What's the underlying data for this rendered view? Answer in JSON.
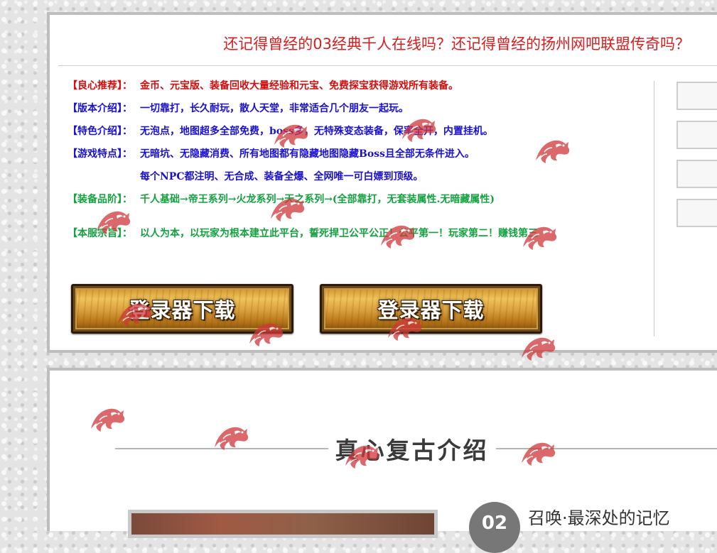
{
  "header": {
    "headline": "还记得曾经的03经典千人在线吗？还记得曾经的扬州网吧联盟传奇吗？"
  },
  "info_rows": [
    {
      "label": "【良心推荐】：",
      "text": "金币、元宝版、装备回收大量经验和元宝、免费探宝获得游戏所有装备。",
      "color": "#d40c0c"
    },
    {
      "label": "【版本介绍】：",
      "text": "一切靠打，长久耐玩，散人天堂，非常适合几个朋友一起玩。",
      "color": "#1a11cf"
    },
    {
      "label": "【特色介绍】：",
      "text": "无泡点，地图超多全部免费，boss多，无特殊变态装备，保率全开，内置挂机。",
      "color": "#1a11cf"
    },
    {
      "label": "【游戏特点】：",
      "text": "无暗坑、无隐藏消费、所有地图都有隐藏地图隐藏Boss且全部无条件进入。",
      "color": "#1a11cf"
    },
    {
      "label": "",
      "text": "每个NPC都注明、无合成、装备全爆、全网唯一可白嫖到顶级。",
      "color": "#1a11cf"
    },
    {
      "label": "【装备品阶】：",
      "text": "千人基础→帝王系列→火龙系列→天之系列→(全部靠打，无套装属性.无暗藏属性)",
      "color": "#14a13f"
    },
    {
      "label": "【本服宗旨】：",
      "text": "以人为本，以玩家为根本建立此平台，誓死捍卫公平公正！公平第一！玩家第二！赚钱第三",
      "color": "#14a13f"
    }
  ],
  "download_buttons": [
    {
      "label": "登录器下载"
    },
    {
      "label": "登录器下载"
    }
  ],
  "section": {
    "title": "真心复古介绍"
  },
  "feature": {
    "number": "02",
    "title": "召唤·最深处的记忆"
  },
  "colors": {
    "headline": "#d81e1e",
    "red": "#d40c0c",
    "blue": "#1a11cf",
    "green": "#14a13f",
    "button_gold": "#dca240",
    "watermark": "#d0383a"
  },
  "icons": {
    "watermark": "dragon-watermark-icon"
  }
}
